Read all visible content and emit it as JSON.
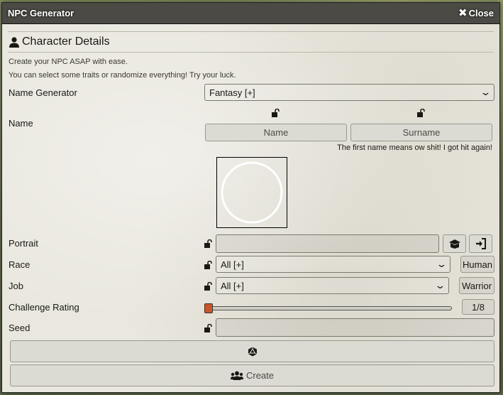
{
  "window": {
    "title": "NPC Generator",
    "close_label": "Close"
  },
  "section": {
    "title": "Character Details",
    "help_line1": "Create your NPC ASAP with ease.",
    "help_line2": "You can select some traits or randomize everything! Try your luck."
  },
  "name_generator": {
    "label": "Name Generator",
    "selected": "Fantasy [+]"
  },
  "name": {
    "label": "Name",
    "first_button": "Name",
    "last_button": "Surname",
    "hint": "The first name means ow shit! I got hit again!"
  },
  "portrait": {
    "label": "Portrait",
    "value": ""
  },
  "race": {
    "label": "Race",
    "selected": "All [+]",
    "result": "Human"
  },
  "job": {
    "label": "Job",
    "selected": "All [+]",
    "result": "Warrior"
  },
  "challenge_rating": {
    "label": "Challenge Rating",
    "value": "1/8",
    "slider_fraction": 0.0
  },
  "seed": {
    "label": "Seed",
    "value": ""
  },
  "actions": {
    "randomize_icon": "d20-icon",
    "create_label": "Create",
    "create_icon": "users-icon"
  },
  "colors": {
    "titlebar": "#4b4a44",
    "slider_thumb": "#c9562b",
    "panel_background": "#e9e7de"
  }
}
